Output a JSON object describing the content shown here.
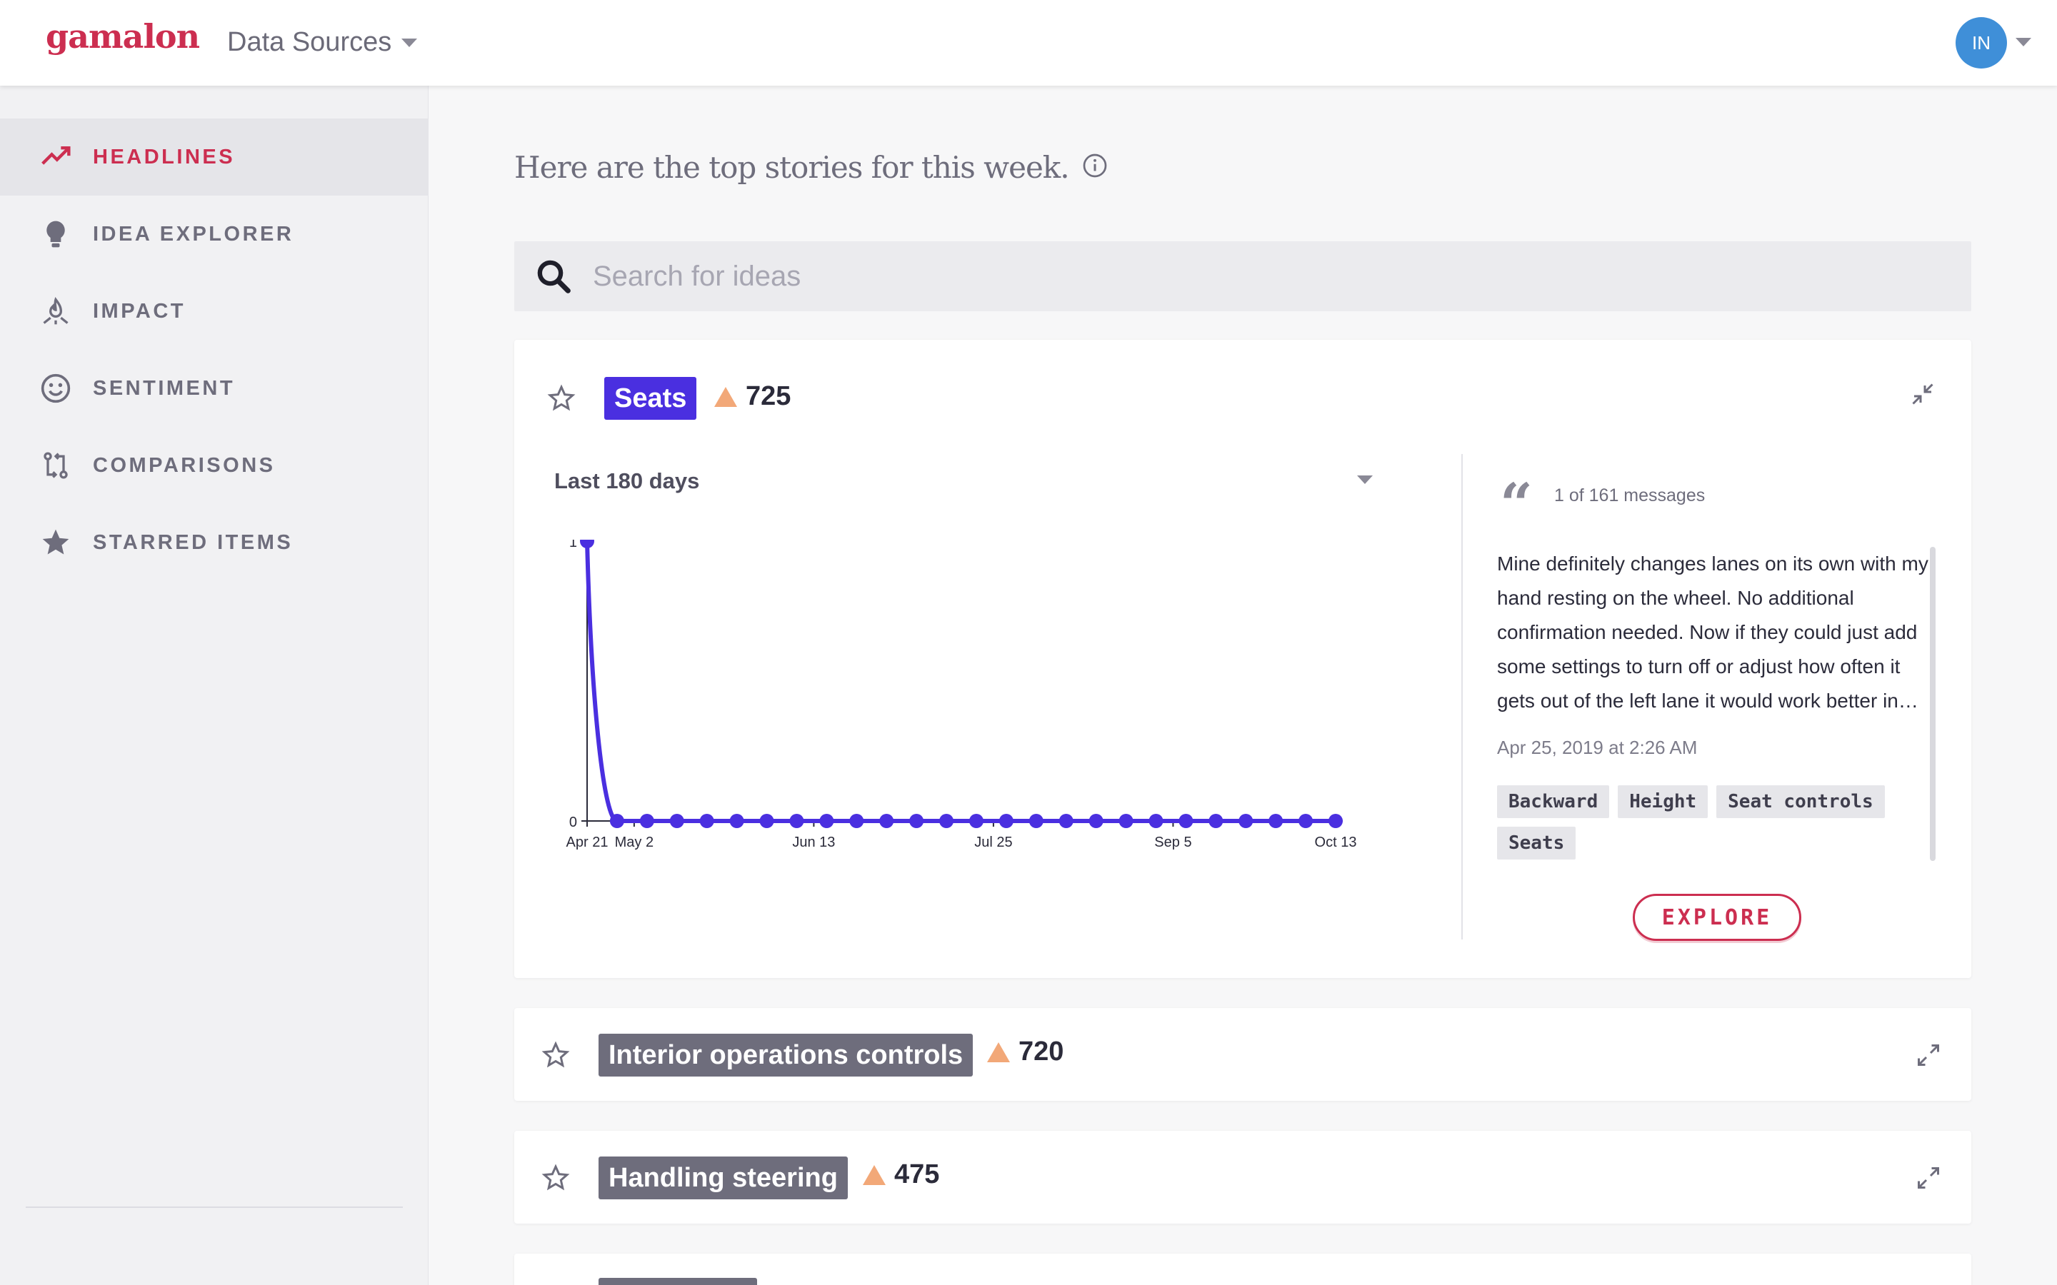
{
  "header": {
    "logo": "gamalon",
    "data_sources_label": "Data Sources",
    "avatar_initials": "IN"
  },
  "sidebar": {
    "items": [
      {
        "label": "HEADLINES",
        "icon": "trending-up-icon",
        "active": true
      },
      {
        "label": "IDEA EXPLORER",
        "icon": "lightbulb-icon",
        "active": false
      },
      {
        "label": "IMPACT",
        "icon": "impact-icon",
        "active": false
      },
      {
        "label": "SENTIMENT",
        "icon": "smiley-icon",
        "active": false
      },
      {
        "label": "COMPARISONS",
        "icon": "compare-icon",
        "active": false
      },
      {
        "label": "STARRED ITEMS",
        "icon": "star-icon",
        "active": false
      }
    ]
  },
  "main": {
    "headline": "Here are the top stories for this week.",
    "search_placeholder": "Search for ideas"
  },
  "cards": [
    {
      "topic": "Seats",
      "count": "725",
      "tag_color": "#4a2fe0",
      "expanded": true,
      "period_label": "Last 180 days",
      "message": {
        "counter": "1 of 161 messages",
        "text": "Mine definitely changes lanes on its own with my hand resting on the wheel. No additional confirmation needed. Now if they could just add some settings to turn off or adjust how often it gets out of the left lane it would work better in…",
        "date": "Apr 25, 2019 at 2:26 AM",
        "chips": [
          "Backward",
          "Height",
          "Seat controls",
          "Seats"
        ]
      },
      "explore_label": "EXPLORE"
    },
    {
      "topic": "Interior operations controls",
      "count": "720",
      "tag_color": "#6e6d7c",
      "expanded": false
    },
    {
      "topic": "Handling steering",
      "count": "475",
      "tag_color": "#6e6d7c",
      "expanded": false
    }
  ],
  "colors": {
    "accent": "#cc2e50",
    "series": "#4a2fe0",
    "trend_up": "#f2a878"
  },
  "chart_data": {
    "type": "line",
    "x": [
      "Apr 21",
      "Apr 28",
      "May 5",
      "May 12",
      "May 19",
      "May 26",
      "Jun 2",
      "Jun 9",
      "Jun 16",
      "Jun 23",
      "Jun 30",
      "Jul 7",
      "Jul 14",
      "Jul 21",
      "Jul 28",
      "Aug 4",
      "Aug 11",
      "Aug 18",
      "Aug 25",
      "Sep 1",
      "Sep 8",
      "Sep 15",
      "Sep 22",
      "Sep 29",
      "Oct 6",
      "Oct 13"
    ],
    "values": [
      1,
      0,
      0,
      0,
      0,
      0,
      0,
      0,
      0,
      0,
      0,
      0,
      0,
      0,
      0,
      0,
      0,
      0,
      0,
      0,
      0,
      0,
      0,
      0,
      0,
      0
    ],
    "x_tick_labels": [
      "Apr 21",
      "May 2",
      "Jun 13",
      "Jul 25",
      "Sep 5",
      "Oct 13"
    ],
    "y_tick_labels": [
      "0",
      "1"
    ],
    "ylim": [
      0,
      1
    ],
    "grid": false,
    "color": "#4a2fe0"
  }
}
